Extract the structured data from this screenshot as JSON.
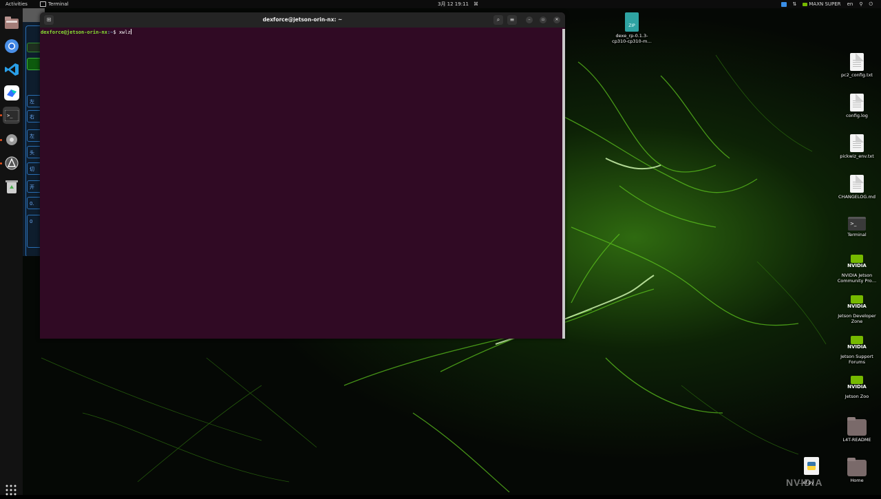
{
  "topbar": {
    "activities": "Activities",
    "app_name": "Terminal",
    "clock": "3月 12  19:11",
    "power_mode": "MAXN SUPER",
    "input_method": "en"
  },
  "dock": {
    "items": [
      "files-icon",
      "chromium-icon",
      "vscode-icon",
      "feishu-icon",
      "terminal-icon",
      "settings-icon",
      "software-updater-icon",
      "trash-icon"
    ],
    "show_apps": "show-apps-icon"
  },
  "background_app": {
    "items": [
      "左",
      "右",
      "左",
      "头",
      "切",
      "开",
      "0.",
      "0"
    ]
  },
  "terminal": {
    "title": "dexforce@jetson-orin-nx: ~",
    "prompt_user": "dexforce@jetson-orin-nx",
    "prompt_path": ":~",
    "prompt_symbol": "$",
    "command": "xwlz"
  },
  "desktop": {
    "zip_file": "dexe_rp-0.1.3-cp310-cp310-m…",
    "files": [
      "pc2_config.txt",
      "config.log",
      "pickwiz_env.txt",
      "CHANGELOG.md",
      "Terminal",
      "NVIDIA Jetson Community Pro…",
      "Jetson Developer Zone",
      "Jetson Support Forums",
      "Jetson Zoo",
      "L4T-README",
      "Home"
    ],
    "python_file": "…ef.py",
    "nvidia_brand": "NVIDIA"
  }
}
